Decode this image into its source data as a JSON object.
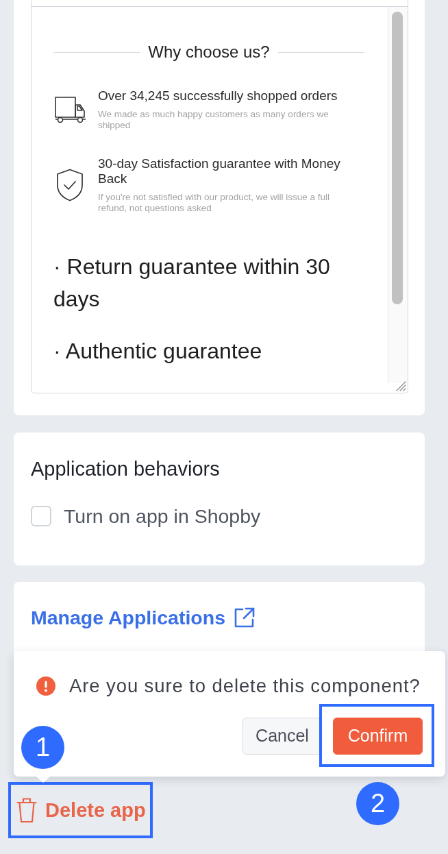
{
  "editor": {
    "heading": "Why choose us?",
    "features": [
      {
        "kind": "truck",
        "title": "Over 34,245 successfully shopped orders",
        "description": "We made as much happy customers as many orders we shipped"
      },
      {
        "kind": "shield",
        "title": "30-day Satisfaction guarantee with Money Back",
        "description": "If you're not satisfied with our product, we will issue a full refund, not questions asked"
      }
    ],
    "bullets": [
      "· Return guarantee within 30 days",
      "· Authentic guarantee"
    ]
  },
  "behaviors": {
    "title": "Application behaviors",
    "options": [
      {
        "label": "Turn on app in Shopby",
        "checked": false
      }
    ]
  },
  "manage_link": {
    "label": "Manage Applications"
  },
  "confirm_popover": {
    "message": "Are you sure to delete this component?",
    "buttons": [
      {
        "kind": "secondary",
        "label": "Cancel",
        "highlighted": false
      },
      {
        "kind": "primary",
        "label": "Confirm",
        "highlighted": true
      }
    ]
  },
  "delete_app": {
    "label": "Delete app",
    "highlighted": true
  },
  "annotations": [
    {
      "label": "1"
    },
    {
      "label": "2"
    }
  ]
}
